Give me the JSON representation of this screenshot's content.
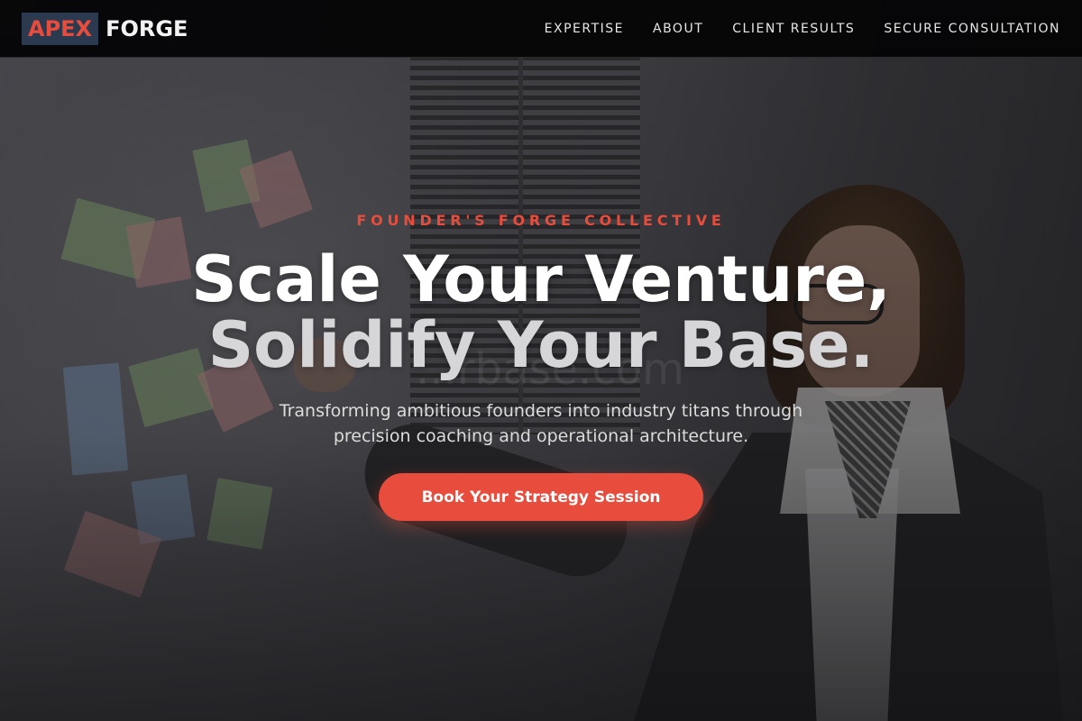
{
  "brand": {
    "name_part1": "APEX",
    "name_part2": "FORGE",
    "accent_color": "#e74c3c",
    "badge_color": "#2c3a50"
  },
  "nav": {
    "links": [
      {
        "label": "EXPERTISE"
      },
      {
        "label": "ABOUT"
      },
      {
        "label": "CLIENT RESULTS"
      },
      {
        "label": "SECURE CONSULTATION"
      }
    ]
  },
  "hero": {
    "eyebrow": "FOUNDER'S FORGE COLLECTIVE",
    "headline_line1": "Scale Your Venture,",
    "headline_line2": "Solidify Your Base.",
    "subhead_line1": "Transforming ambitious founders into industry titans through",
    "subhead_line2": "precision coaching and operational architecture.",
    "cta_label": "Book Your Strategy Session",
    "background_image": "woman-with-glasses-at-sticky-note-wall-photo",
    "watermark": "...rbase.com"
  }
}
